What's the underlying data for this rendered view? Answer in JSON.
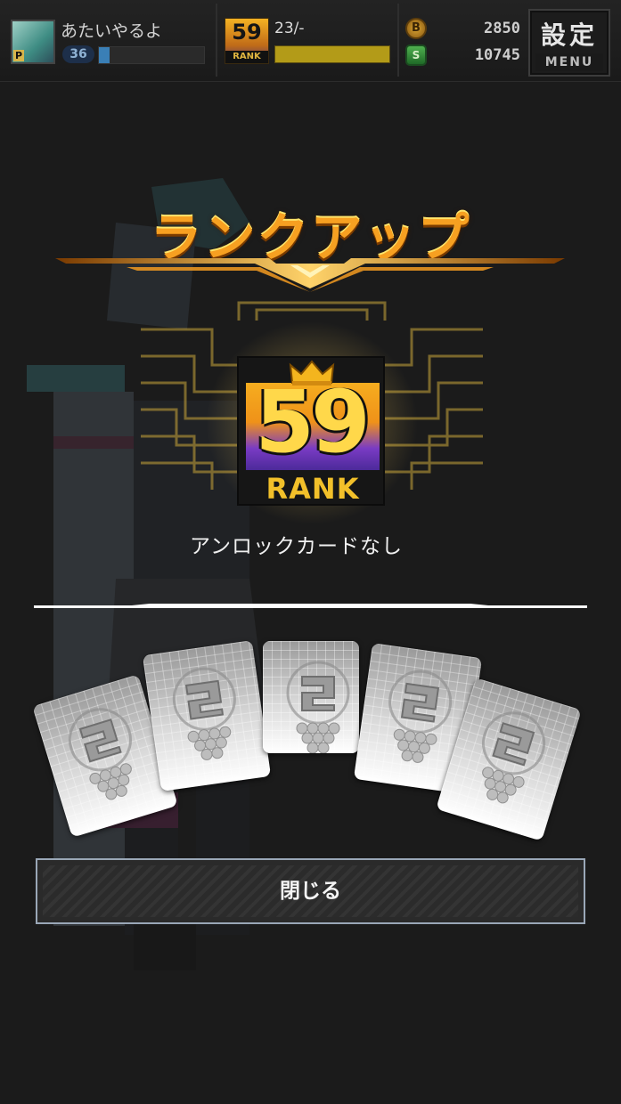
{
  "header": {
    "player": {
      "name": "あたいやるよ",
      "avatar_badge": "P",
      "level": "36",
      "exp_progress": 0.1
    },
    "rank": {
      "number": "59",
      "label": "RANK",
      "progress_text": "23/-",
      "progress": 1.0
    },
    "currency": {
      "coins": "2850",
      "coin_icon": "B",
      "gems": "10745",
      "gem_icon": "S"
    },
    "settings": {
      "label": "設定",
      "sublabel": "MENU"
    }
  },
  "dialog": {
    "title": "ランクアップ",
    "rank_number": "59",
    "rank_label": "RANK",
    "unlock_message": "アンロックカードなし",
    "close_label": "閉じる",
    "card_count": 5
  },
  "colors": {
    "accent_orange": "#f7a021",
    "rank_purple": "#6a34b4",
    "exp_blue": "#3a7fb6",
    "rank_bar_gold": "#b39b18",
    "button_border": "#9aa7b7"
  },
  "icons": [
    "avatar-image",
    "rank-badge-icon",
    "coin-icon",
    "gem-icon",
    "crown-icon",
    "card-placeholder-icon"
  ]
}
